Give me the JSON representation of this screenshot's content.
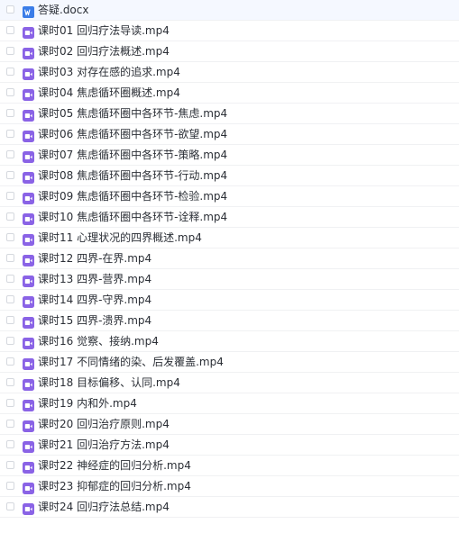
{
  "files": [
    {
      "name": "答疑.docx",
      "icon": "word-doc-icon",
      "type": "doc"
    },
    {
      "name": "课时01 回归疗法导读.mp4",
      "icon": "video-file-icon",
      "type": "video"
    },
    {
      "name": "课时02 回归疗法概述.mp4",
      "icon": "video-file-icon",
      "type": "video"
    },
    {
      "name": "课时03 对存在感的追求.mp4",
      "icon": "video-file-icon",
      "type": "video"
    },
    {
      "name": "课时04 焦虑循环圈概述.mp4",
      "icon": "video-file-icon",
      "type": "video"
    },
    {
      "name": "课时05 焦虑循环圈中各环节-焦虑.mp4",
      "icon": "video-file-icon",
      "type": "video"
    },
    {
      "name": "课时06 焦虑循环圈中各环节-欲望.mp4",
      "icon": "video-file-icon",
      "type": "video"
    },
    {
      "name": "课时07 焦虑循环圈中各环节-策略.mp4",
      "icon": "video-file-icon",
      "type": "video"
    },
    {
      "name": "课时08 焦虑循环圈中各环节-行动.mp4",
      "icon": "video-file-icon",
      "type": "video"
    },
    {
      "name": "课时09 焦虑循环圈中各环节-检验.mp4",
      "icon": "video-file-icon",
      "type": "video"
    },
    {
      "name": "课时10 焦虑循环圈中各环节-诠释.mp4",
      "icon": "video-file-icon",
      "type": "video"
    },
    {
      "name": "课时11 心理状况的四界概述.mp4",
      "icon": "video-file-icon",
      "type": "video"
    },
    {
      "name": "课时12 四界-在界.mp4",
      "icon": "video-file-icon",
      "type": "video"
    },
    {
      "name": "课时13 四界-营界.mp4",
      "icon": "video-file-icon",
      "type": "video"
    },
    {
      "name": "课时14 四界-守界.mp4",
      "icon": "video-file-icon",
      "type": "video"
    },
    {
      "name": "课时15 四界-溃界.mp4",
      "icon": "video-file-icon",
      "type": "video"
    },
    {
      "name": "课时16 觉察、接纳.mp4",
      "icon": "video-file-icon",
      "type": "video"
    },
    {
      "name": "课时17 不同情绪的染、后发覆盖.mp4",
      "icon": "video-file-icon",
      "type": "video"
    },
    {
      "name": "课时18 目标偏移、认同.mp4",
      "icon": "video-file-icon",
      "type": "video"
    },
    {
      "name": "课时19 内和外.mp4",
      "icon": "video-file-icon",
      "type": "video"
    },
    {
      "name": "课时20 回归治疗原则.mp4",
      "icon": "video-file-icon",
      "type": "video"
    },
    {
      "name": "课时21 回归治疗方法.mp4",
      "icon": "video-file-icon",
      "type": "video"
    },
    {
      "name": "课时22 神经症的回归分析.mp4",
      "icon": "video-file-icon",
      "type": "video"
    },
    {
      "name": "课时23 抑郁症的回归分析.mp4",
      "icon": "video-file-icon",
      "type": "video"
    },
    {
      "name": "课时24 回归疗法总结.mp4",
      "icon": "video-file-icon",
      "type": "video"
    }
  ],
  "colors": {
    "video_icon": "#8a63e6",
    "doc_icon": "#3b7de8",
    "text": "#2b2f36",
    "row_divider": "#f0f1f3"
  }
}
